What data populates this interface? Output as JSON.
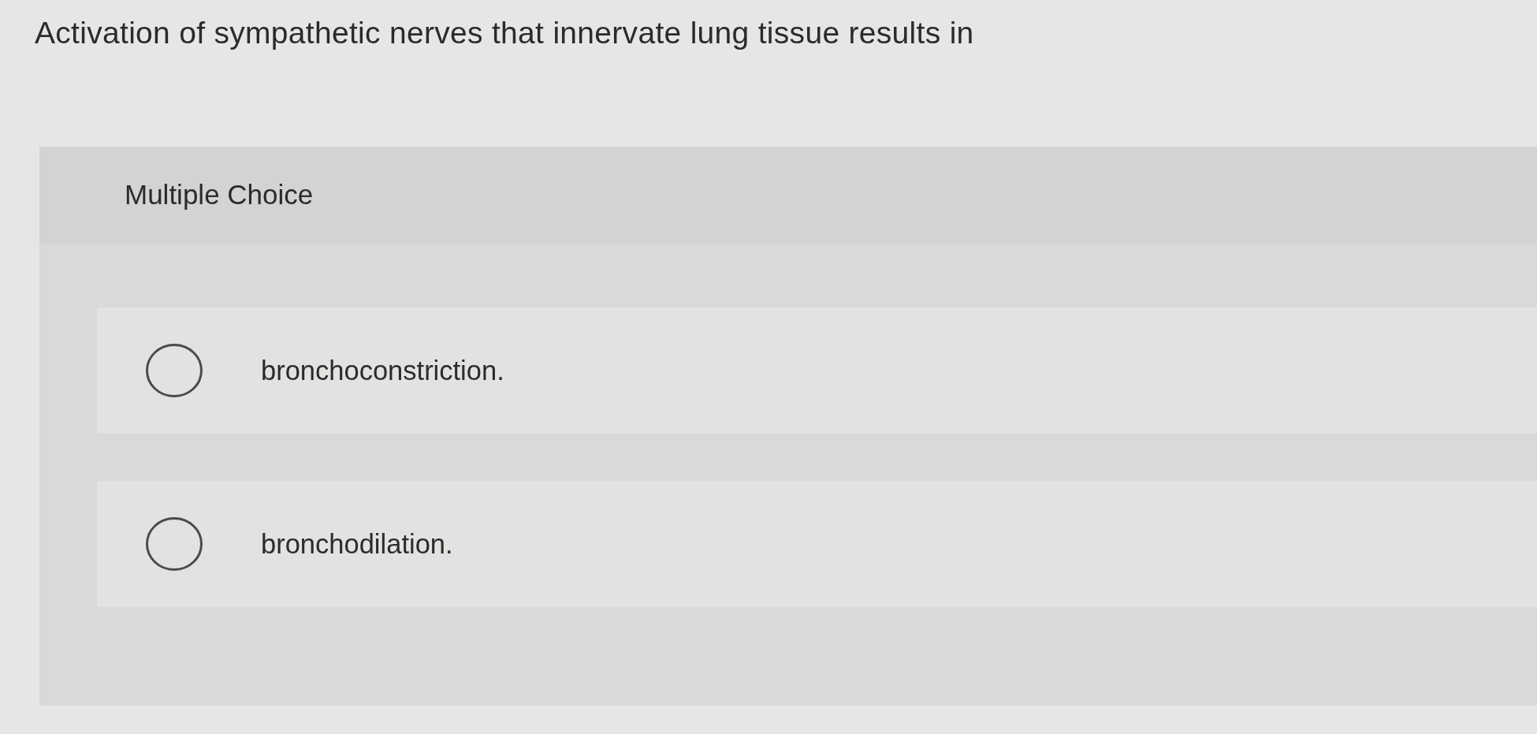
{
  "question": {
    "text": "Activation of sympathetic nerves that innervate lung tissue results in"
  },
  "panel": {
    "type_label": "Multiple Choice",
    "options": [
      {
        "text": "bronchoconstriction.",
        "selected": false
      },
      {
        "text": "bronchodilation.",
        "selected": false
      }
    ]
  }
}
